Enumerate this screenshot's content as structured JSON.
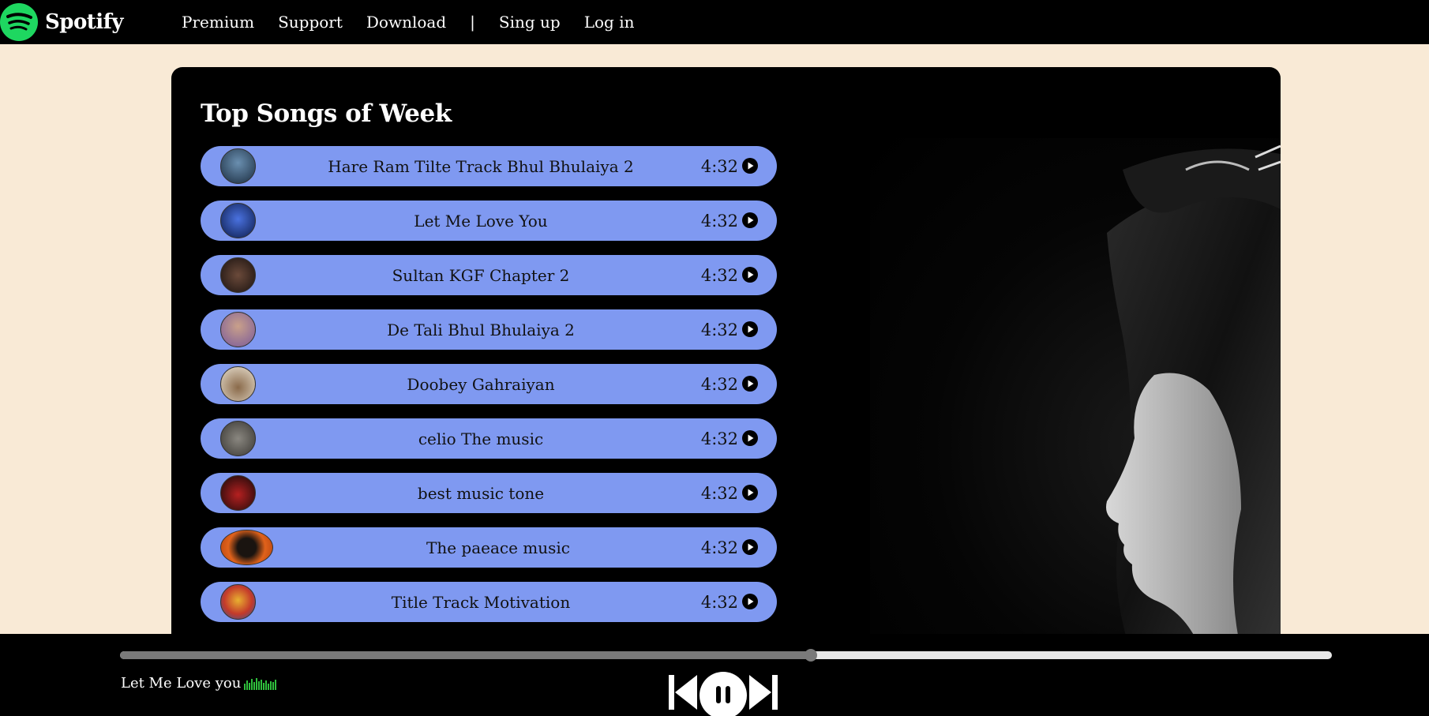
{
  "brand": {
    "name": "Spotify"
  },
  "nav": {
    "links": [
      "Premium",
      "Support",
      "Download"
    ],
    "separator": "|",
    "auth": [
      "Sing up",
      "Log in"
    ]
  },
  "section": {
    "title": "Top Songs of Week"
  },
  "songs": [
    {
      "title": "Hare Ram Tilte Track Bhul Bhulaiya 2",
      "duration": "4:32",
      "thumb_color": "#3a5a7a"
    },
    {
      "title": "Let Me Love You",
      "duration": "4:32",
      "thumb_color": "#1c3a8c"
    },
    {
      "title": "Sultan KGF Chapter 2",
      "duration": "4:32",
      "thumb_color": "#3b2a26"
    },
    {
      "title": "De Tali Bhul Bhulaiya 2",
      "duration": "4:32",
      "thumb_color": "#8d6fa6"
    },
    {
      "title": "Doobey Gahraiyan",
      "duration": "4:32",
      "thumb_color": "#b59a7a"
    },
    {
      "title": "celio The music",
      "duration": "4:32",
      "thumb_color": "#5d5a55"
    },
    {
      "title": "best music tone",
      "duration": "4:32",
      "thumb_color": "#7a1a1a"
    },
    {
      "title": "The paeace music",
      "duration": "4:32",
      "thumb_color": "#e0621b"
    },
    {
      "title": "Title Track Motivation",
      "duration": "4:32",
      "thumb_color": "#c43a2a"
    }
  ],
  "player": {
    "now_playing": "Let Me Love you",
    "progress": 0.57
  },
  "colors": {
    "page_bg": "#f9ead6",
    "song_row": "#7f99f1",
    "brand_green": "#1ed760",
    "eq_green": "#2fbf3c"
  },
  "icons": {
    "logo": "spotify-logo-icon",
    "play": "play-circle-icon",
    "previous": "skip-previous-icon",
    "pause": "pause-icon",
    "next": "skip-next-icon",
    "equalizer": "equalizer-icon"
  }
}
